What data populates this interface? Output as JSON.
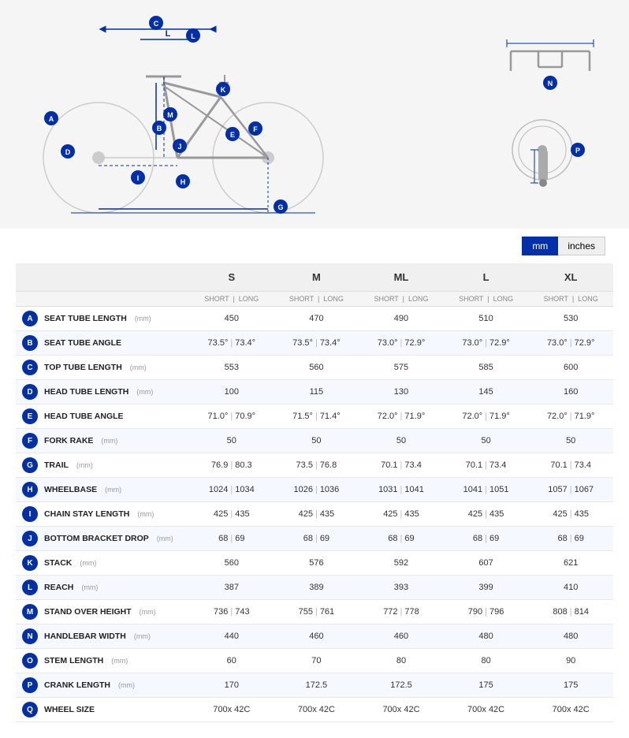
{
  "diagram": {
    "alt": "Bike geometry diagram"
  },
  "units": {
    "mm_label": "mm",
    "inches_label": "inches",
    "active": "mm"
  },
  "table": {
    "sizes": [
      "S",
      "M",
      "ML",
      "L",
      "XL"
    ],
    "sub_headers": [
      "SHORT",
      "LONG",
      "SHORT",
      "LONG",
      "SHORT",
      "LONG",
      "SHORT",
      "LONG",
      "SHORT",
      "LONG"
    ],
    "rows": [
      {
        "letter": "A",
        "name": "SEAT TUBE LENGTH",
        "unit": "(mm)",
        "s": "450",
        "m": "470",
        "ml": "490",
        "l": "510",
        "xl": "530",
        "has_short_long": false
      },
      {
        "letter": "B",
        "name": "SEAT TUBE ANGLE",
        "unit": "",
        "s_short": "73.5°",
        "s_long": "73.4°",
        "m_short": "73.5°",
        "m_long": "73.4°",
        "ml_short": "73.0°",
        "ml_long": "72.9°",
        "l_short": "73.0°",
        "l_long": "72.9°",
        "xl_short": "73.0°",
        "xl_long": "72.9°",
        "has_short_long": true
      },
      {
        "letter": "C",
        "name": "TOP TUBE LENGTH",
        "unit": "(mm)",
        "s": "553",
        "m": "560",
        "ml": "575",
        "l": "585",
        "xl": "600",
        "has_short_long": false
      },
      {
        "letter": "D",
        "name": "HEAD TUBE LENGTH",
        "unit": "(mm)",
        "s": "100",
        "m": "115",
        "ml": "130",
        "l": "145",
        "xl": "160",
        "has_short_long": false
      },
      {
        "letter": "E",
        "name": "HEAD TUBE ANGLE",
        "unit": "",
        "s_short": "71.0°",
        "s_long": "70.9°",
        "m_short": "71.5°",
        "m_long": "71.4°",
        "ml_short": "72.0°",
        "ml_long": "71.9°",
        "l_short": "72.0°",
        "l_long": "71.9°",
        "xl_short": "72.0°",
        "xl_long": "71.9°",
        "has_short_long": true
      },
      {
        "letter": "F",
        "name": "FORK RAKE",
        "unit": "(mm)",
        "s": "50",
        "m": "50",
        "ml": "50",
        "l": "50",
        "xl": "50",
        "has_short_long": false
      },
      {
        "letter": "G",
        "name": "TRAIL",
        "unit": "(mm)",
        "s_short": "76.9",
        "s_long": "80.3",
        "m_short": "73.5",
        "m_long": "76.8",
        "ml_short": "70.1",
        "ml_long": "73.4",
        "l_short": "70.1",
        "l_long": "73.4",
        "xl_short": "70.1",
        "xl_long": "73.4",
        "has_short_long": true
      },
      {
        "letter": "H",
        "name": "WHEELBASE",
        "unit": "(mm)",
        "s_short": "1024",
        "s_long": "1034",
        "m_short": "1026",
        "m_long": "1036",
        "ml_short": "1031",
        "ml_long": "1041",
        "l_short": "1041",
        "l_long": "1051",
        "xl_short": "1057",
        "xl_long": "1067",
        "has_short_long": true
      },
      {
        "letter": "I",
        "name": "CHAIN STAY LENGTH",
        "unit": "(mm)",
        "s_short": "425",
        "s_long": "435",
        "m_short": "425",
        "m_long": "435",
        "ml_short": "425",
        "ml_long": "435",
        "l_short": "425",
        "l_long": "435",
        "xl_short": "425",
        "xl_long": "435",
        "has_short_long": true
      },
      {
        "letter": "J",
        "name": "BOTTOM BRACKET DROP",
        "unit": "(mm)",
        "s_short": "68",
        "s_long": "69",
        "m_short": "68",
        "m_long": "69",
        "ml_short": "68",
        "ml_long": "69",
        "l_short": "68",
        "l_long": "69",
        "xl_short": "68",
        "xl_long": "69",
        "has_short_long": true
      },
      {
        "letter": "K",
        "name": "STACK",
        "unit": "(mm)",
        "s": "560",
        "m": "576",
        "ml": "592",
        "l": "607",
        "xl": "621",
        "has_short_long": false
      },
      {
        "letter": "L",
        "name": "REACH",
        "unit": "(mm)",
        "s": "387",
        "m": "389",
        "ml": "393",
        "l": "399",
        "xl": "410",
        "has_short_long": false
      },
      {
        "letter": "M",
        "name": "STAND OVER HEIGHT",
        "unit": "(mm)",
        "s_short": "736",
        "s_long": "743",
        "m_short": "755",
        "m_long": "761",
        "ml_short": "772",
        "ml_long": "778",
        "l_short": "790",
        "l_long": "796",
        "xl_short": "808",
        "xl_long": "814",
        "has_short_long": true
      },
      {
        "letter": "N",
        "name": "HANDLEBAR WIDTH",
        "unit": "(mm)",
        "s": "440",
        "m": "460",
        "ml": "460",
        "l": "480",
        "xl": "480",
        "has_short_long": false
      },
      {
        "letter": "O",
        "name": "STEM LENGTH",
        "unit": "(mm)",
        "s": "60",
        "m": "70",
        "ml": "80",
        "l": "80",
        "xl": "90",
        "has_short_long": false
      },
      {
        "letter": "P",
        "name": "CRANK LENGTH",
        "unit": "(mm)",
        "s": "170",
        "m": "172.5",
        "ml": "172.5",
        "l": "175",
        "xl": "175",
        "has_short_long": false
      },
      {
        "letter": "Q",
        "name": "WHEEL SIZE",
        "unit": "",
        "s_short": "700x 42C",
        "s_long": "",
        "m_short": "700x 42C",
        "m_long": "",
        "ml_short": "700x 42C",
        "ml_long": "",
        "l_short": "700x 42C",
        "l_long": "",
        "xl_short": "700x 42C",
        "xl_long": "",
        "has_short_long": true,
        "wheel": true
      }
    ]
  }
}
